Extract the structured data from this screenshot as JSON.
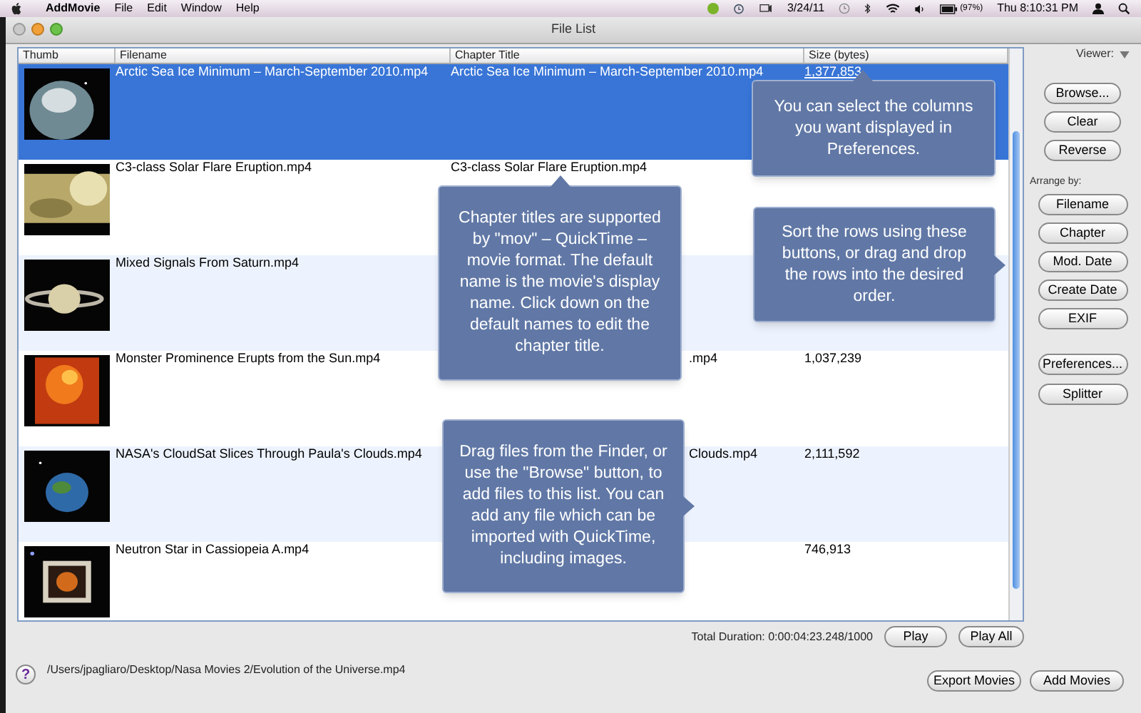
{
  "menubar": {
    "app": "AddMovie",
    "menus": [
      "File",
      "Edit",
      "Window",
      "Help"
    ],
    "date": "3/24/11",
    "battery": "(97%)",
    "clock": "Thu 8:10:31 PM"
  },
  "window": {
    "title": "File List"
  },
  "table": {
    "columns": [
      "Thumb",
      "Filename",
      "Chapter Title",
      "Size (bytes)"
    ],
    "rows": [
      {
        "filename": "Arctic Sea Ice Minimum – March-September 2010.mp4",
        "chapter": "Arctic Sea Ice Minimum – March-September 2010.mp4",
        "size": "1,377,853",
        "selected": true
      },
      {
        "filename": "C3-class Solar Flare Eruption.mp4",
        "chapter": "C3-class Solar Flare Eruption.mp4",
        "selected": false
      },
      {
        "filename": "Mixed Signals From Saturn.mp4",
        "selected": false
      },
      {
        "filename": "Monster Prominence Erupts from the Sun.mp4",
        "chapter_tail": ".mp4",
        "size": "1,037,239",
        "selected": false
      },
      {
        "filename": "NASA's CloudSat Slices Through Paula's Clouds.mp4",
        "chapter_tail": "Clouds.mp4",
        "size": "2,111,592",
        "selected": false
      },
      {
        "filename": "Neutron Star in Cassiopeia A.mp4",
        "size": "746,913",
        "selected": false
      }
    ]
  },
  "sidebar": {
    "viewer_label": "Viewer:",
    "top_buttons": [
      "Browse...",
      "Clear",
      "Reverse"
    ],
    "arrange_label": "Arrange by:",
    "arrange_buttons": [
      "Filename",
      "Chapter",
      "Mod. Date",
      "Create Date",
      "EXIF"
    ],
    "bottom_buttons": [
      "Preferences...",
      "Splitter"
    ]
  },
  "tooltips": [
    {
      "text": "You can select the columns you want displayed in Preferences.",
      "kind": "up"
    },
    {
      "text": "Chapter titles are supported by \"mov\" – QuickTime – movie format. The default name is the movie's display name. Click down on the default names to edit the chapter title.",
      "kind": "up"
    },
    {
      "text": "Sort the rows using these buttons, or drag and drop the rows into the desired order.",
      "kind": "right"
    },
    {
      "text": "Drag files from the Finder, or use the \"Browse\" button, to add files to this list. You can add any file which can be imported with QuickTime, including images.",
      "kind": "right"
    }
  ],
  "footer": {
    "total_duration": "Total Duration: 0:00:04:23.248/1000",
    "play_buttons": [
      "Play",
      "Play All"
    ],
    "help": "?",
    "path": "/Users/jpagliaro/Desktop/Nasa Movies 2/Evolution of the Universe.mp4",
    "action_buttons": [
      "Export Movies",
      "Add Movies"
    ]
  }
}
